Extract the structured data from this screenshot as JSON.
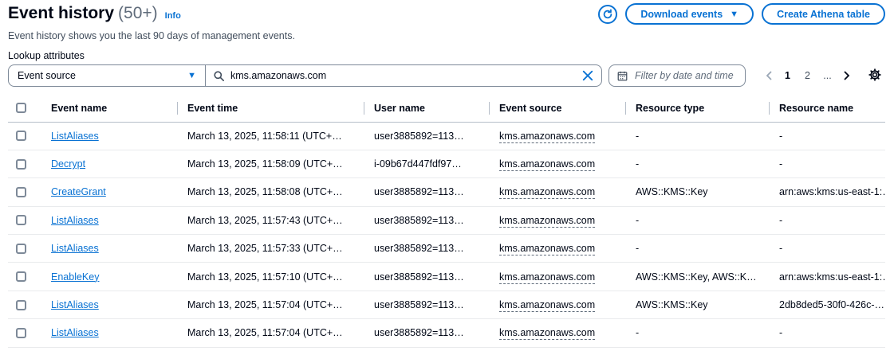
{
  "header": {
    "title": "Event history",
    "count": "(50+)",
    "info": "Info",
    "description": "Event history shows you the last 90 days of management events.",
    "download_label": "Download events",
    "athena_label": "Create Athena table"
  },
  "filters": {
    "lookup_label": "Lookup attributes",
    "attribute": "Event source",
    "value": "kms.amazonaws.com",
    "date_placeholder": "Filter by date and time"
  },
  "pagination": {
    "pages": [
      "1",
      "2",
      "..."
    ],
    "current": "1"
  },
  "table": {
    "columns": [
      "Event name",
      "Event time",
      "User name",
      "Event source",
      "Resource type",
      "Resource name"
    ],
    "rows": [
      {
        "event_name": "ListAliases",
        "event_time": "March 13, 2025, 11:58:11 (UTC+…",
        "user_name": "user3885892=113…",
        "event_source": "kms.amazonaws.com",
        "resource_type": "-",
        "resource_name": "-"
      },
      {
        "event_name": "Decrypt",
        "event_time": "March 13, 2025, 11:58:09 (UTC+…",
        "user_name": "i-09b67d447fdf97…",
        "event_source": "kms.amazonaws.com",
        "resource_type": "-",
        "resource_name": "-"
      },
      {
        "event_name": "CreateGrant",
        "event_time": "March 13, 2025, 11:58:08 (UTC+…",
        "user_name": "user3885892=113…",
        "event_source": "kms.amazonaws.com",
        "resource_type": "AWS::KMS::Key",
        "resource_name": "arn:aws:kms:us-east-1:…"
      },
      {
        "event_name": "ListAliases",
        "event_time": "March 13, 2025, 11:57:43 (UTC+…",
        "user_name": "user3885892=113…",
        "event_source": "kms.amazonaws.com",
        "resource_type": "-",
        "resource_name": "-"
      },
      {
        "event_name": "ListAliases",
        "event_time": "March 13, 2025, 11:57:33 (UTC+…",
        "user_name": "user3885892=113…",
        "event_source": "kms.amazonaws.com",
        "resource_type": "-",
        "resource_name": "-"
      },
      {
        "event_name": "EnableKey",
        "event_time": "March 13, 2025, 11:57:10 (UTC+…",
        "user_name": "user3885892=113…",
        "event_source": "kms.amazonaws.com",
        "resource_type": "AWS::KMS::Key, AWS::K…",
        "resource_name": "arn:aws:kms:us-east-1:…"
      },
      {
        "event_name": "ListAliases",
        "event_time": "March 13, 2025, 11:57:04 (UTC+…",
        "user_name": "user3885892=113…",
        "event_source": "kms.amazonaws.com",
        "resource_type": "AWS::KMS::Key",
        "resource_name": "2db8ded5-30f0-426c-…"
      },
      {
        "event_name": "ListAliases",
        "event_time": "March 13, 2025, 11:57:04 (UTC+…",
        "user_name": "user3885892=113…",
        "event_source": "kms.amazonaws.com",
        "resource_type": "-",
        "resource_name": "-"
      }
    ]
  },
  "colors": {
    "accent": "#0972d3",
    "text": "#000716",
    "muted": "#5f6b7a",
    "border": "#7d8998"
  },
  "icons": [
    "refresh-icon",
    "caret-down-icon",
    "search-icon",
    "close-icon",
    "calendar-icon",
    "chevron-left-icon",
    "chevron-right-icon",
    "gear-icon",
    "checkbox"
  ]
}
